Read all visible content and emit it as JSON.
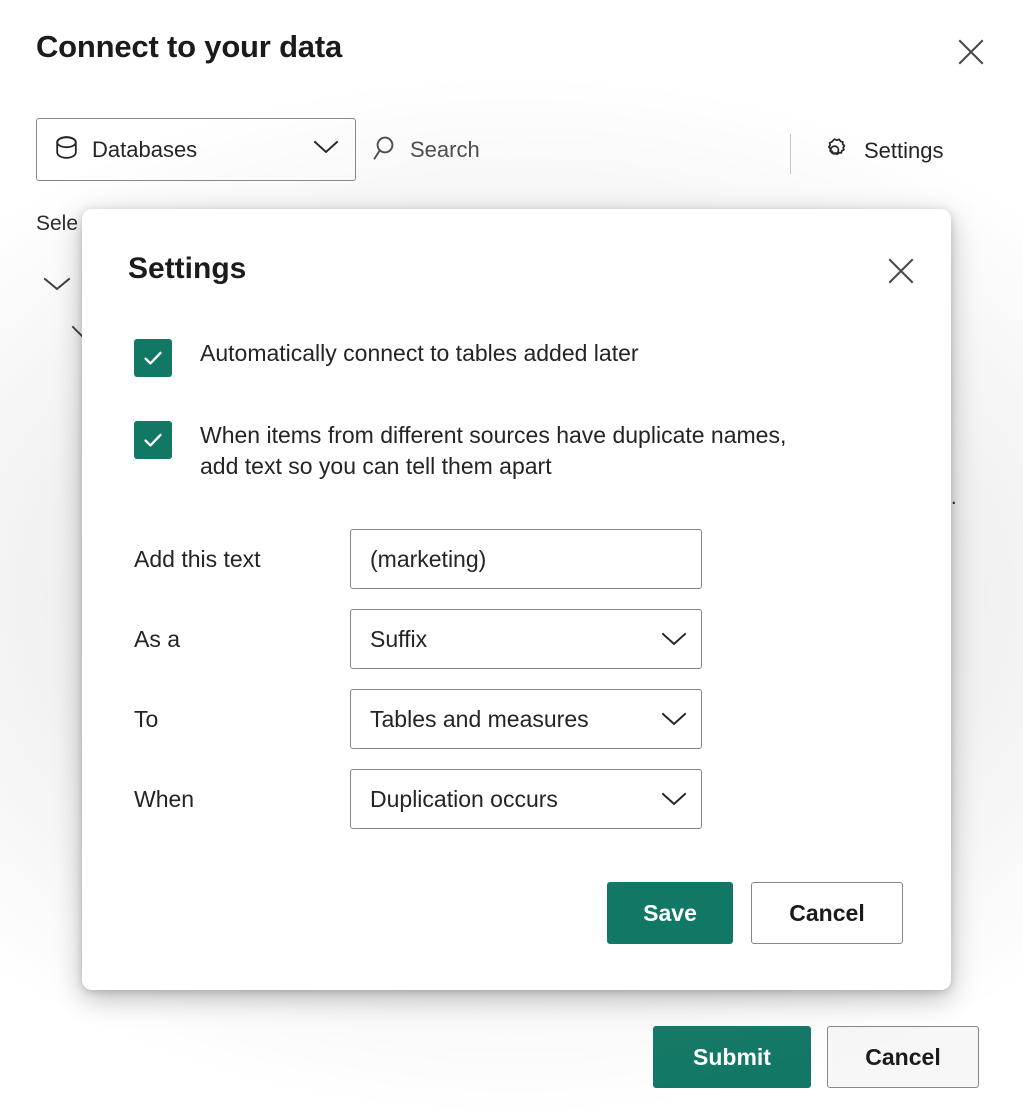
{
  "panel": {
    "title": "Connect to your data",
    "close_icon": "close-icon",
    "toolbar": {
      "source_picker": {
        "icon": "database-icon",
        "label": "Databases",
        "chevron": "chevron-down-icon"
      },
      "search": {
        "icon": "search-icon",
        "placeholder": "Search",
        "value": ""
      },
      "settings": {
        "icon": "gear-icon",
        "label": "Settings"
      }
    },
    "body": {
      "select_hint": "Sele",
      "tree_chevron": "chevron-down-icon",
      "tree_chevron_collapsed": "chevron-right-icon",
      "overflow_ellipsis": ".."
    },
    "footer": {
      "submit_label": "Submit",
      "cancel_label": "Cancel"
    }
  },
  "settings_dialog": {
    "title": "Settings",
    "close_icon": "close-icon",
    "checkboxes": [
      {
        "name": "auto-connect",
        "label": "Automatically connect to tables added later",
        "checked": true
      },
      {
        "name": "duplicate-names",
        "label": "When items from different sources have duplicate names,\nadd text so you can tell them apart",
        "checked": true
      }
    ],
    "fields": [
      {
        "name": "add-this-text",
        "label": "Add this text",
        "type": "text",
        "value": "(marketing)"
      },
      {
        "name": "as-a",
        "label": "As a",
        "type": "select",
        "value": "Suffix",
        "chevron": "chevron-down-icon"
      },
      {
        "name": "to",
        "label": "To",
        "type": "select",
        "value": "Tables and measures",
        "chevron": "chevron-down-icon"
      },
      {
        "name": "when",
        "label": "When",
        "type": "select",
        "value": "Duplication occurs",
        "chevron": "chevron-down-icon"
      }
    ],
    "save_label": "Save",
    "cancel_label": "Cancel"
  },
  "colors": {
    "accent": "#117865",
    "accent_text": "#ffffff",
    "border": "#8a8886",
    "text": "#242424",
    "surface": "#ffffff"
  }
}
